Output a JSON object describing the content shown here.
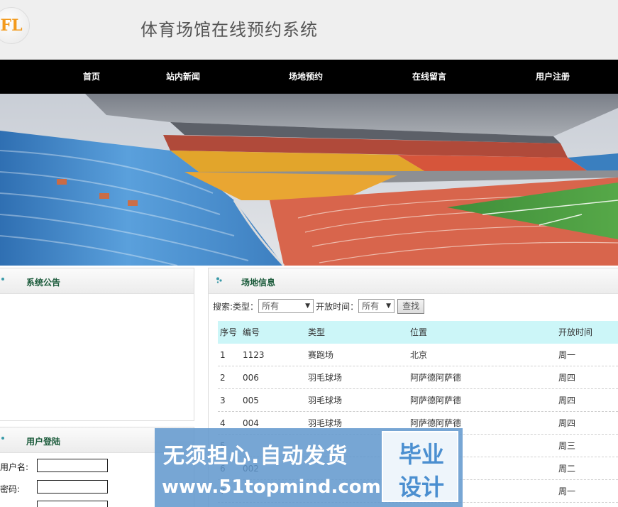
{
  "header": {
    "logo_text": "FL",
    "title": "体育场馆在线预约系统"
  },
  "nav": {
    "items": [
      "首页",
      "站内新闻",
      "场地预约",
      "在线留言",
      "用户注册"
    ]
  },
  "notice_panel": {
    "title": "系统公告"
  },
  "venue_panel": {
    "title": "场地信息",
    "search": {
      "label": "搜索:",
      "type_label": "类型：",
      "type_value": "所有",
      "time_label": "开放时间：",
      "time_value": "所有",
      "button": "查找"
    },
    "columns": [
      "序号",
      "编号",
      "类型",
      "位置",
      "开放时间"
    ],
    "rows": [
      [
        "1",
        "1123",
        "赛跑场",
        "北京",
        "周一"
      ],
      [
        "2",
        "006",
        "羽毛球场",
        "阿萨德阿萨德",
        "周四"
      ],
      [
        "3",
        "005",
        "羽毛球场",
        "阿萨德阿萨德",
        "周四"
      ],
      [
        "4",
        "004",
        "羽毛球场",
        "阿萨德阿萨德",
        "周四"
      ],
      [
        "5",
        "",
        "",
        "",
        "周三"
      ],
      [
        "6",
        "002",
        "",
        "",
        "周二"
      ],
      [
        "7",
        "",
        "",
        "",
        "周一"
      ]
    ]
  },
  "login_panel": {
    "title": "用户登陆",
    "username_label": "用户名:",
    "password_label": "密码:"
  },
  "watermark": {
    "line1": "无须担心.自动发货",
    "url": "www.51topmind.com",
    "badge_line1": "毕业",
    "badge_line2": "设计"
  },
  "colors": {
    "nav_bg": "#000000",
    "table_head_bg": "#ccf6f8",
    "panel_title": "#1a5a3a"
  }
}
